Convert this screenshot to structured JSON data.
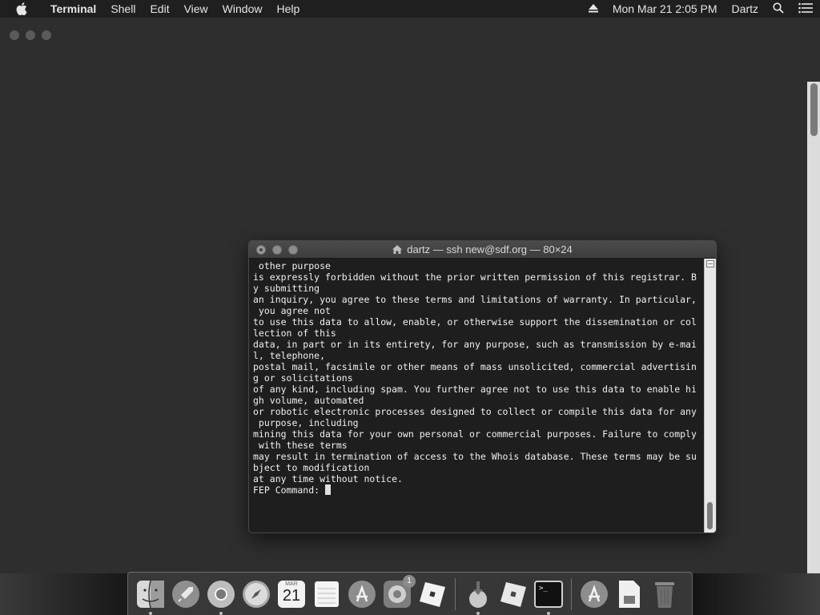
{
  "menubar": {
    "app_name": "Terminal",
    "menus": [
      "Shell",
      "Edit",
      "View",
      "Window",
      "Help"
    ],
    "clock": "Mon Mar 21  2:05 PM",
    "user": "Dartz"
  },
  "terminal": {
    "title": "dartz — ssh new@sdf.org — 80×24",
    "lines": [
      " other purpose",
      "is expressly forbidden without the prior written permission of this registrar. B",
      "y submitting",
      "an inquiry, you agree to these terms and limitations of warranty. In particular,",
      " you agree not",
      "to use this data to allow, enable, or otherwise support the dissemination or col",
      "lection of this",
      "data, in part or in its entirety, for any purpose, such as transmission by e-mai",
      "l, telephone,",
      "postal mail, facsimile or other means of mass unsolicited, commercial advertisin",
      "g or solicitations",
      "of any kind, including spam. You further agree not to use this data to enable hi",
      "gh volume, automated",
      "or robotic electronic processes designed to collect or compile this data for any",
      " purpose, including",
      "mining this data for your own personal or commercial purposes. Failure to comply",
      " with these terms",
      "may result in termination of access to the Whois database. These terms may be su",
      "bject to modification",
      "at any time without notice.",
      "",
      "",
      "",
      "FEP Command: "
    ]
  },
  "dock": {
    "calendar_month": "MAR",
    "calendar_day": "21",
    "updates_badge": "1",
    "terminal_prompt": ">_"
  }
}
